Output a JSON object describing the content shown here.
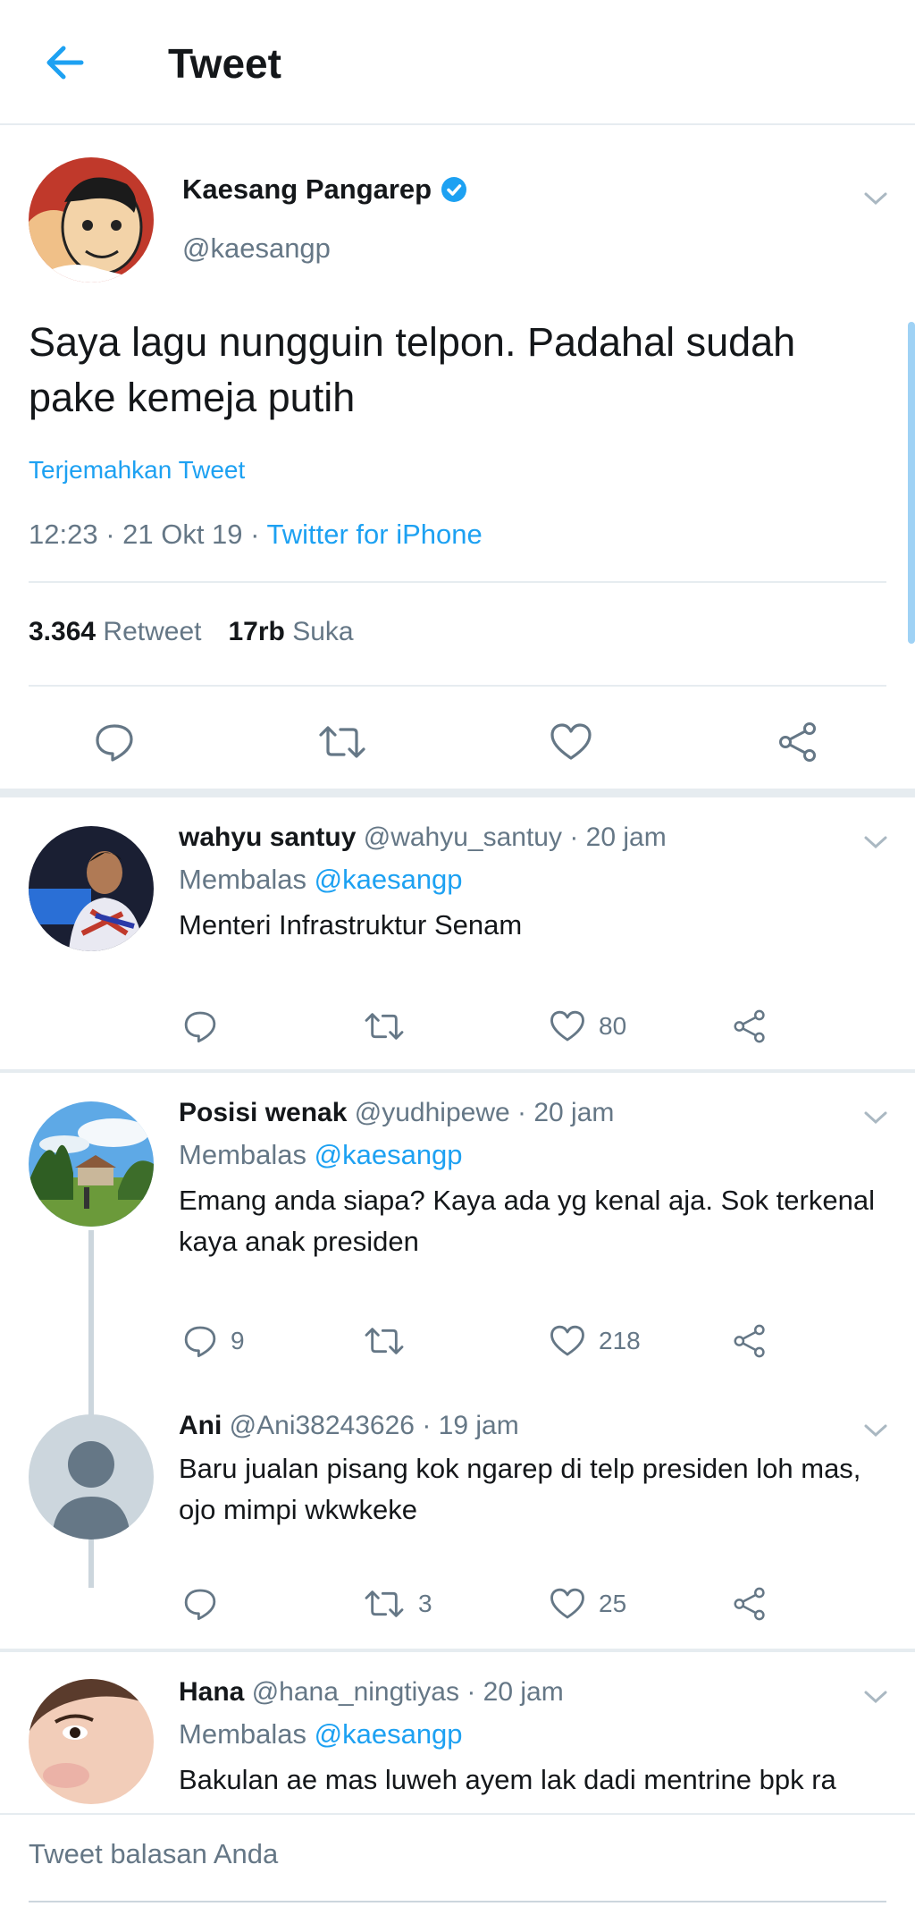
{
  "header": {
    "title": "Tweet"
  },
  "main_tweet": {
    "name": "Kaesang Pangarep",
    "handle": "@kaesangp",
    "text": "Saya lagu nungguin telpon. Padahal sudah pake kemeja putih",
    "translate": "Terjemahkan Tweet",
    "time": "12:23 · 21 Okt 19 · ",
    "source": "Twitter for iPhone",
    "retweets": "3.364",
    "retweet_label": "Retweet",
    "likes": "17rb",
    "likes_label": "Suka"
  },
  "replies": [
    {
      "name": "wahyu santuy",
      "handle": "@wahyu_santuy",
      "time": "· 20 jam",
      "replying_label": "Membalas",
      "replying_to": "@kaesangp",
      "text": "Menteri Infrastruktur Senam",
      "reply_count": "",
      "retweet_count": "",
      "like_count": "80"
    },
    {
      "name": "Posisi wenak",
      "handle": "@yudhipewe",
      "time": "· 20 jam",
      "replying_label": "Membalas",
      "replying_to": "@kaesangp",
      "text": "Emang anda siapa? Kaya ada yg kenal aja. Sok terkenal kaya anak presiden",
      "reply_count": "9",
      "retweet_count": "",
      "like_count": "218"
    },
    {
      "name": "Ani",
      "handle": "@Ani38243626",
      "time": "· 19 jam",
      "text": "Baru jualan pisang kok ngarep di telp presiden loh mas, ojo mimpi wkwkeke",
      "reply_count": "",
      "retweet_count": "3",
      "like_count": "25"
    },
    {
      "name": "Hana",
      "handle": "@hana_ningtiyas",
      "time": "· 20 jam",
      "replying_label": "Membalas",
      "replying_to": "@kaesangp",
      "text": "Bakulan ae mas luweh ayem lak dadi mentrine bpk ra"
    }
  ],
  "composer": {
    "placeholder": "Tweet balasan Anda"
  },
  "colors": {
    "accent": "#1da1f2",
    "muted": "#657786",
    "border": "#e6ecf0"
  }
}
